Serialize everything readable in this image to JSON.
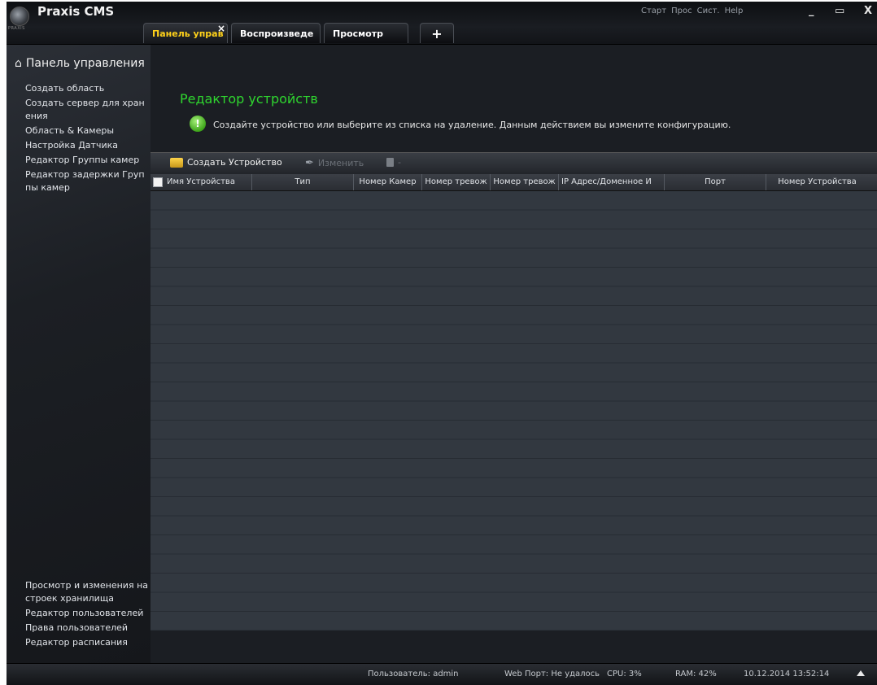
{
  "app": {
    "title": "Praxis CMS",
    "logo_text": "PRAXIS"
  },
  "tabs": [
    {
      "label": "Панель управ",
      "active": true
    },
    {
      "label": "Воспроизведе",
      "active": false
    },
    {
      "label": "Просмотр",
      "active": false
    }
  ],
  "top_menu": [
    "Старт",
    "Прос",
    "Сист.",
    "Help"
  ],
  "window_controls": {
    "minimize": "_",
    "maximize": "▭",
    "close": "X"
  },
  "sidebar": {
    "header": "Панель управления",
    "items": [
      "Создать область",
      "Создать сервер для хранения",
      "Область & Камеры",
      "Настройка Датчика",
      "Редактор Группы камер",
      "Редактор задержки Группы камер"
    ],
    "bottom_items": [
      "Просмотр и изменения настроек хранилища",
      "Редактор пользователей",
      "Права пользователей",
      "Редактор расписания"
    ]
  },
  "main": {
    "title": "Редактор устройств",
    "info_text": "Создайте устройство или выберите из списка на удаление. Данным действием вы измените конфигурацию.",
    "toolbar": {
      "add_label": "Создать Устройство",
      "edit_label": "Изменить",
      "delete_label": "-"
    },
    "table": {
      "columns": [
        "Имя Устройства",
        "Тип",
        "Номер Камер",
        "Номер тревож",
        "Номер тревож",
        "IP Адрес/Доменное И",
        "Порт",
        "Номер Устройства"
      ],
      "rows": []
    }
  },
  "status": {
    "user": "Пользователь: admin",
    "web_port": "Web Порт: Не удалось",
    "cpu": "CPU: 3%",
    "ram": "RAM: 42%",
    "datetime": "10.12.2014 13:52:14"
  },
  "colors": {
    "accent_green": "#2fd62f",
    "active_tab_text": "#ffd21a",
    "background": "#1b1e23"
  },
  "icons": [
    "home-icon",
    "info-icon",
    "add-device-icon",
    "edit-icon",
    "delete-icon",
    "add-tab-icon",
    "expand-arrow-icon"
  ]
}
